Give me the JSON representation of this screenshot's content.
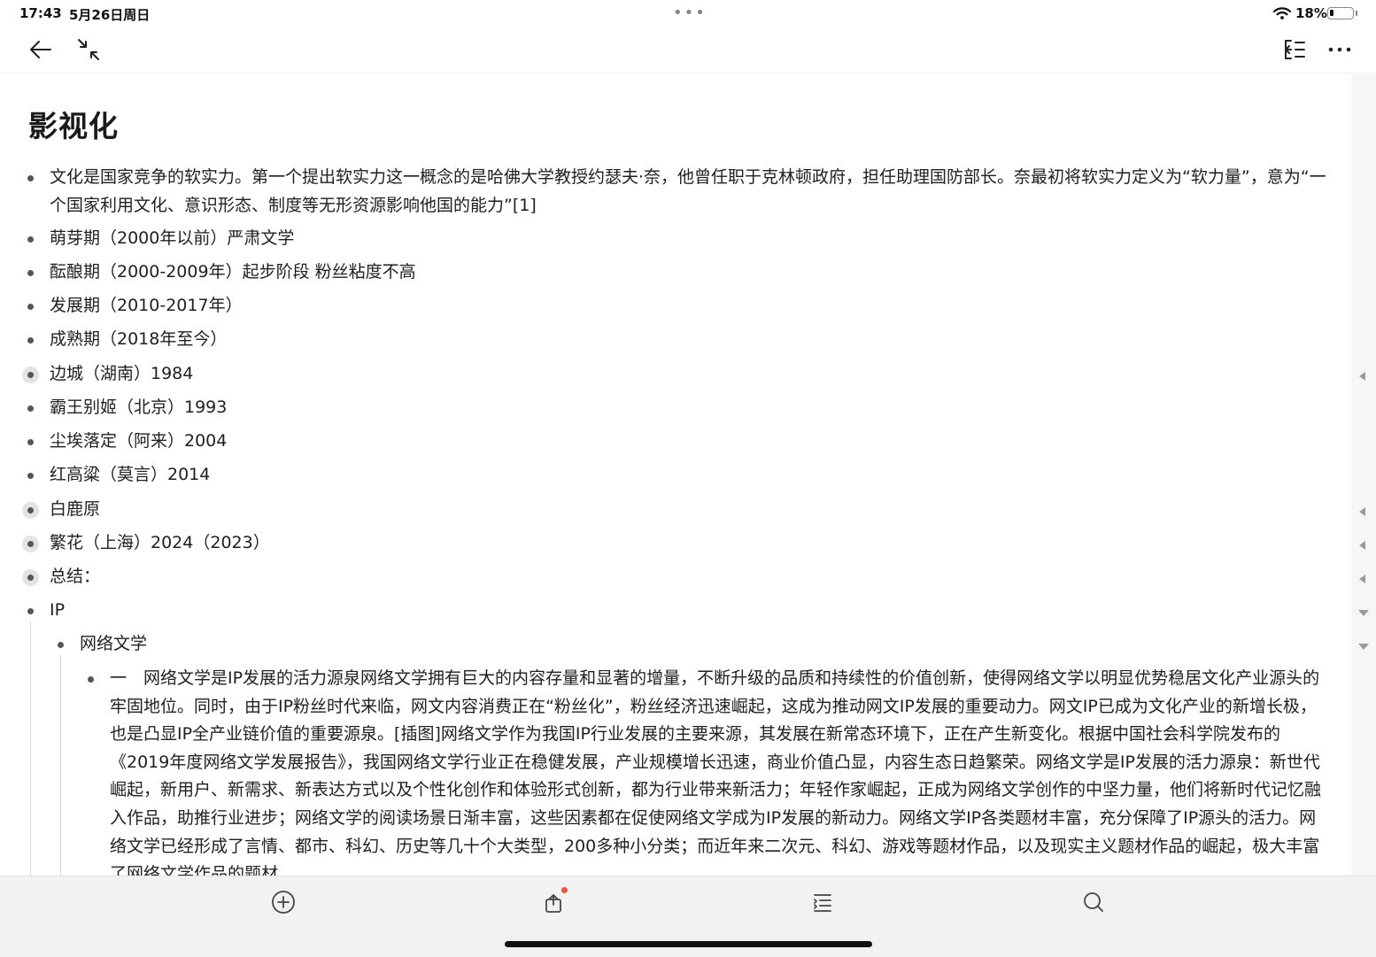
{
  "status_bar": {
    "time": "17:43",
    "date": "5月26日周日",
    "dots": "•••",
    "battery_percent": "18%",
    "battery_level": 0.18
  },
  "toolbar": {
    "back_icon": "arrow-left-icon",
    "collapse_icon": "collapse-arrows-icon",
    "outline_icon": "outline-toggle-icon",
    "more_icon": "more-horizontal-icon"
  },
  "document": {
    "title": "影视化",
    "items": [
      {
        "text": "文化是国家竞争的软实力。第一个提出软实力这一概念的是哈佛大学教授约瑟夫·奈，他曾任职于克林顿政府，担任助理国防部长。奈最初将软实力定义为“软力量”，意为“一个国家利用文化、意识形态、制度等无形资源影响他国的能力”[1]",
        "collapsed": false
      },
      {
        "text": "萌芽期（2000年以前）严肃文学",
        "collapsed": false
      },
      {
        "text": "酝酿期（2000-2009年）起步阶段 粉丝粘度不高",
        "collapsed": false
      },
      {
        "text": "发展期（2010-2017年）",
        "collapsed": false
      },
      {
        "text": "成熟期（2018年至今）",
        "collapsed": false
      },
      {
        "text": "边城（湖南）1984",
        "collapsed": true
      },
      {
        "text": "霸王别姬（北京）1993",
        "collapsed": false
      },
      {
        "text": "尘埃落定（阿来）2004",
        "collapsed": false
      },
      {
        "text": "红高粱（莫言）2014",
        "collapsed": false
      },
      {
        "text": "白鹿原",
        "collapsed": true
      },
      {
        "text": "繁花（上海）2024（2023）",
        "collapsed": true
      },
      {
        "text": "总结：",
        "collapsed": true
      },
      {
        "text": "IP",
        "collapsed": false
      },
      {
        "text": "网络文学",
        "collapsed": false
      },
      {
        "text": "一　网络文学是IP发展的活力源泉网络文学拥有巨大的内容存量和显著的增量，不断升级的品质和持续性的价值创新，使得网络文学以明显优势稳居文化产业源头的牢固地位。同时，由于IP粉丝时代来临，网文内容消费正在“粉丝化”，粉丝经济迅速崛起，这成为推动网文IP发展的重要动力。网文IP已成为文化产业的新增长极，也是凸显IP全产业链价值的重要源泉。[插图]网络文学作为我国IP行业发展的主要来源，其发展在新常态环境下，正在产生新变化。根据中国社会科学院发布的《2019年度网络文学发展报告》，我国网络文学行业正在稳健发展，产业规模增长迅速，商业价值凸显，内容生态日趋繁荣。网络文学是IP发展的活力源泉：新世代崛起，新用户、新需求、新表达方式以及个性化创作和体验形式创新，都为行业带来新活力；年轻作家崛起，正成为网络文学创作的中坚力量，他们将新时代记忆融入作品，助推行业进步；网络文学的阅读场景日渐丰富，这些因素都在促使网络文学成为IP发展的新动力。网络文学IP各类题材丰富，充分保障了IP源头的活力。网络文学已经形成了言情、都市、科幻、历史等几十个大类型，200多种小分类；而近年来二次元、科幻、游戏等题材作品，以及现实主义题材作品的崛起，极大丰富了网络文学作品的题材",
        "collapsed": false
      }
    ]
  },
  "right_rail": {
    "markers": [
      "collapse-left-arrow",
      "collapse-left-arrow",
      "collapse-left-arrow",
      "collapse-left-arrow",
      "expand-down-arrow",
      "expand-down-arrow"
    ]
  },
  "bottom_bar": {
    "buttons": [
      "add-circle-icon",
      "share-icon",
      "checklist-icon",
      "search-icon"
    ]
  }
}
